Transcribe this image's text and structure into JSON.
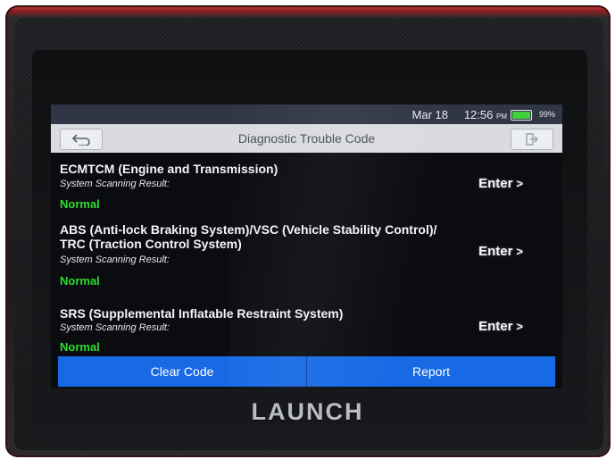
{
  "device": {
    "brand": "LAUNCH"
  },
  "statusbar": {
    "date": "Mar 18",
    "time": "12:56",
    "meridiem": "PM",
    "battery_percent": "99%",
    "battery_level": 0.99
  },
  "titlebar": {
    "title": "Diagnostic Trouble Code",
    "back_icon": "return-arrow-icon",
    "exit_icon": "exit-icon"
  },
  "systems": [
    {
      "name": "ECMTCM (Engine and Transmission)",
      "result_label": "System Scanning Result:",
      "status": "Normal",
      "action": "Enter",
      "action_icon": "chevron-right-icon"
    },
    {
      "name": "ABS (Anti-lock Braking System)/VSC (Vehicle Stability Control)/ TRC (Traction Control System)",
      "result_label": "System Scanning Result:",
      "status": "Normal",
      "action": "Enter",
      "action_icon": "chevron-right-icon"
    },
    {
      "name": "SRS (Supplemental Inflatable Restraint System)",
      "result_label": "System Scanning Result:",
      "status": "Normal",
      "action": "Enter",
      "action_icon": "chevron-right-icon"
    }
  ],
  "bottombar": {
    "clear_code": "Clear Code",
    "report": "Report"
  },
  "colors": {
    "accent": "#1769e4",
    "status_normal": "#2fdc2f",
    "battery": "#3dd13d"
  }
}
